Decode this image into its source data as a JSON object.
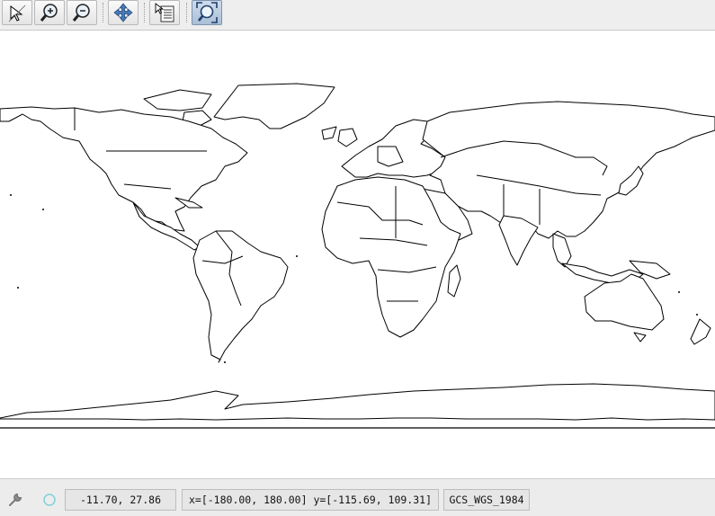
{
  "toolbar": {
    "tools": [
      {
        "name": "select-tool",
        "icon": "arrow-pointer-icon"
      },
      {
        "name": "zoom-in-tool",
        "icon": "zoom-in-icon"
      },
      {
        "name": "zoom-out-tool",
        "icon": "zoom-out-icon"
      },
      {
        "name": "pan-tool",
        "icon": "pan-arrows-icon"
      },
      {
        "name": "info-tool",
        "icon": "info-list-icon"
      },
      {
        "name": "zoom-extent-tool",
        "icon": "zoom-extent-icon",
        "active": true
      }
    ]
  },
  "map": {
    "content": "world country boundaries",
    "colors": {
      "background": "#ffffff",
      "outline": "#000000"
    }
  },
  "status": {
    "cursor_coords": "-11.70, 27.86",
    "extent": "x=[-180.00, 180.00] y=[-115.69, 109.31]",
    "crs": "GCS_WGS_1984",
    "icons": [
      "wrench-icon",
      "circle-icon"
    ]
  }
}
